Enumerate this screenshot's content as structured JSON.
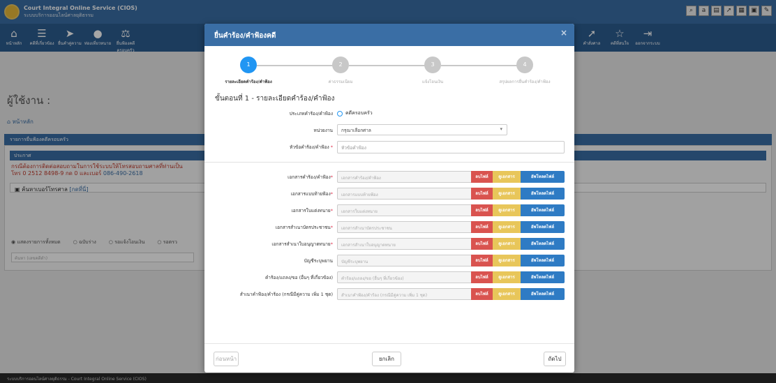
{
  "app": {
    "title": "Court Integral Online Service (CIOS)",
    "subtitle": "ระบบบริการออนไลน์ศาลยุติธรรม",
    "user_prefix": "ผู้ใช้งาน : ",
    "breadcrumb": "หน้าหลัก",
    "nav_items": [
      {
        "icon": "home-icon",
        "glyph": "⌂",
        "label": "หน้าหลัก"
      },
      {
        "icon": "list-icon",
        "glyph": "☰",
        "label": "คดีที่เกี่ยวข้อง"
      },
      {
        "icon": "send-icon",
        "glyph": "➤",
        "label": "ยื่นคำคู่ความ"
      },
      {
        "icon": "chat-icon",
        "glyph": "●",
        "label": "ท่องเที่ยวทนาย"
      },
      {
        "icon": "scale-icon",
        "glyph": "⚖",
        "label": "ยื่นฟ้องคดีครอบครัว"
      }
    ],
    "nav_right": [
      {
        "icon": "gavel-icon",
        "glyph": "➚",
        "label": "คำสั่งศาล"
      },
      {
        "icon": "star-icon",
        "glyph": "☆",
        "label": "คดีที่สนใจ"
      },
      {
        "icon": "logout-icon",
        "glyph": "⇥",
        "label": "ออกจากระบบ"
      }
    ],
    "panel_title": "รายการยื่นฟ้องคดีครอบครัว",
    "announce_title": "ประกาศ",
    "announce_line1": "กรณีต้องการติดต่อสอบถามในการใช้ระบบให้โทรสอบถามศาลที่ท่านเป็น",
    "announce_line2": "โทร 0 2512 8498-9 กด 0 และเบอร์ ",
    "announce_phone": "086-490-2618",
    "search_phone_label": "ค้นหาเบอร์โทรศาล",
    "search_phone_link": "[กดที่นี่]",
    "radio_options": [
      "แสดงรายการทั้งหมด",
      "ฉบับร่าง",
      "รอแจ้งโอนเงิน",
      "รอตรว"
    ],
    "search_placeholder": "ค้นหา (เลขคดีดำ)",
    "footer": "ระบบบริการออนไลน์ศาลยุติธรรม - Court Integral Online Service (CIOS)"
  },
  "modal": {
    "title": "ยื่นคำร้อง/คำฟ้องคดี",
    "close_glyph": "×",
    "steps": [
      {
        "num": "1",
        "label": "รายละเอียดคำร้อง/คำฟ้อง",
        "active": true
      },
      {
        "num": "2",
        "label": "ค่าธรรมเนียม",
        "active": false
      },
      {
        "num": "3",
        "label": "แจ้งโอนเงิน",
        "active": false
      },
      {
        "num": "4",
        "label": "สรุปผลการยื่นคำร้อง/คำฟ้อง",
        "active": false
      }
    ],
    "step_heading": "ขั้นตอนที่ 1 - รายละเอียดคำร้อง/คำฟ้อง",
    "type_label": "ประเภทคำร้อง/คำฟ้อง",
    "type_value": "คดีครอบครัว",
    "agency_label": "หน่วยงาน",
    "agency_value": "กรุณาเลือกศาล",
    "subject_label": "หัวข้อคำร้อง/คำฟ้อง",
    "subject_placeholder": "หัวข้อคำฟ้อง",
    "required_mark": "*",
    "btn_delete": "ลบไฟล์",
    "btn_view": "ดูเอกสาร",
    "btn_upload": "อัพโหลดไฟล์",
    "documents": [
      {
        "label": "เอกสารคำร้อง/คำฟ้อง",
        "required": true,
        "placeholder": "เอกสารคำร้อง/คำฟ้อง"
      },
      {
        "label": "เอกสารแบบท้ายฟ้อง",
        "required": true,
        "placeholder": "เอกสารแบบท้ายฟ้อง"
      },
      {
        "label": "เอกสารใบแต่งทนาย",
        "required": true,
        "placeholder": "เอกสารใบแต่งทนาย"
      },
      {
        "label": "เอกสารสำเนาบัตรประชาชน",
        "required": true,
        "placeholder": "เอกสารสำเนาบัตรประชาชน"
      },
      {
        "label": "เอกสารสำเนาใบอนุญาตทนาย",
        "required": true,
        "placeholder": "เอกสารสำเนาใบอนุญาตทนาย"
      },
      {
        "label": "บัญชีระบุพยาน",
        "required": false,
        "placeholder": "บัญชีระบุพยาน"
      },
      {
        "label": "คำร้อง/แถลง/ขอ (อื่นๆ ที่เกี่ยวข้อง)",
        "required": false,
        "placeholder": "คำร้อง/แถลง/ขอ (อื่นๆ ที่เกี่ยวข้อง)"
      },
      {
        "label": "สำเนาคำฟ้อง/คำร้อง (กรณีมีคู่ความ เพิ่ม 1 ชุด)",
        "required": false,
        "placeholder": "สำเนาคำฟ้อง/คำร้อง (กรณีมีคู่ความ เพิ่ม 1 ชุด)"
      }
    ],
    "btn_prev": "ก่อนหน้า",
    "btn_cancel": "ยกเลิก",
    "btn_next": "ถัดไป"
  },
  "colors": {
    "primary": "#3a6ea5",
    "step_active": "#2196f3",
    "delete": "#d9534f",
    "view": "#e8c65a",
    "upload": "#2e7bc4"
  }
}
